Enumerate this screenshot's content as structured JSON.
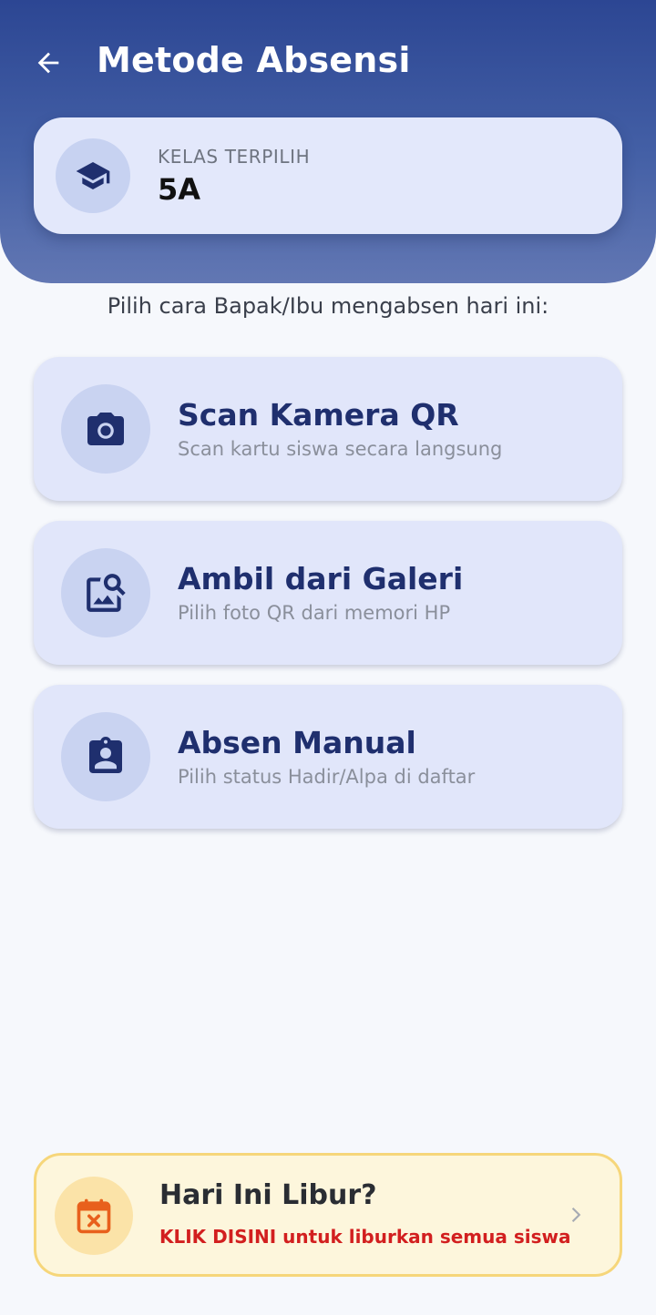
{
  "header": {
    "title": "Metode Absensi",
    "back_icon": "arrow-left-icon"
  },
  "selected_class": {
    "label": "KELAS TERPILIH",
    "value": "5A",
    "icon": "graduation-cap-icon"
  },
  "prompt": "Pilih cara Bapak/Ibu mengabsen hari ini:",
  "methods": [
    {
      "title": "Scan Kamera QR",
      "subtitle": "Scan kartu siswa secara langsung",
      "icon": "camera-icon"
    },
    {
      "title": "Ambil dari Galeri",
      "subtitle": "Pilih foto QR dari memori HP",
      "icon": "image-search-icon"
    },
    {
      "title": "Absen Manual",
      "subtitle": "Pilih status Hadir/Alpa di daftar",
      "icon": "clipboard-user-icon"
    }
  ],
  "holiday": {
    "title": "Hari Ini Libur?",
    "subtitle": "KLIK DISINI untuk liburkan semua siswa",
    "icon": "calendar-x-icon",
    "chevron_icon": "chevron-right-icon"
  },
  "colors": {
    "header_top": "#2c4693",
    "header_bottom": "#6277b3",
    "accent_navy": "#1f2f6e",
    "holiday_bg": "#fdf6dc",
    "holiday_border": "#f6d67a",
    "holiday_red": "#d21f1f",
    "holiday_icon": "#e8601c"
  }
}
